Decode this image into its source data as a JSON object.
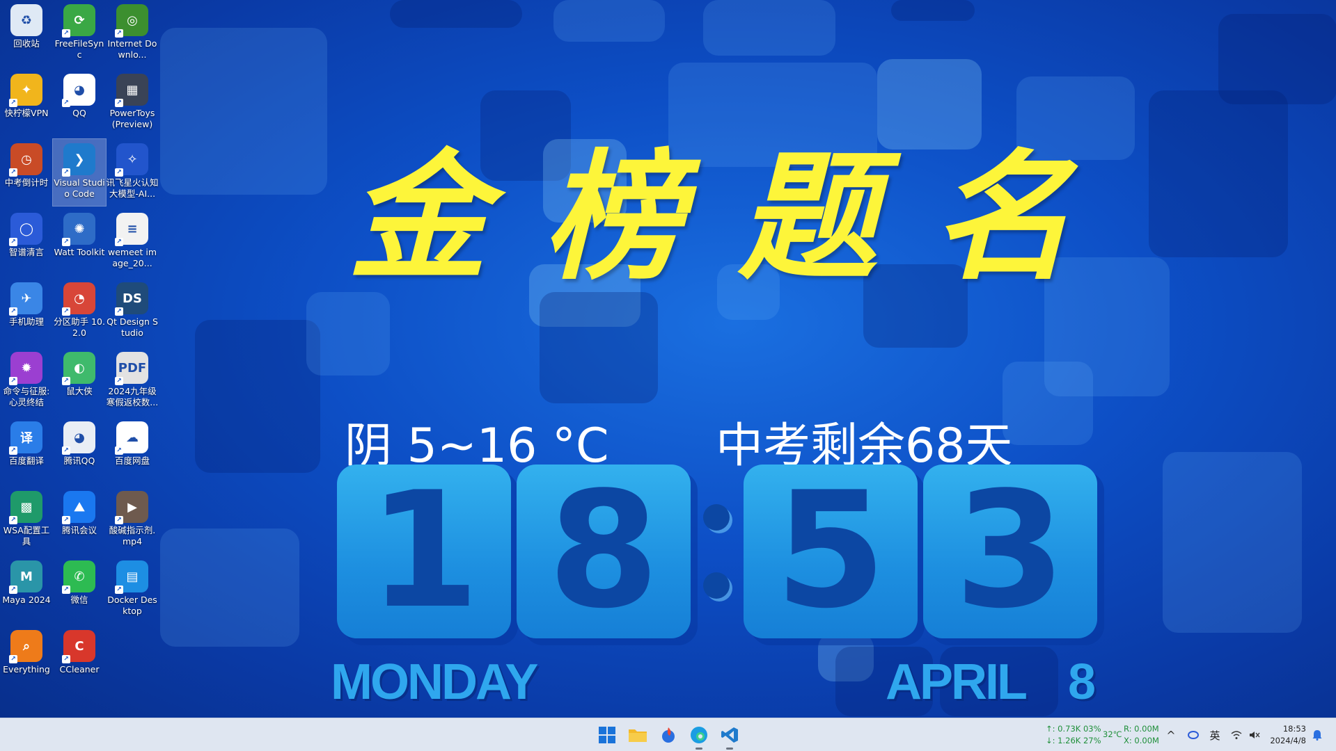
{
  "desktop_icons": [
    {
      "label": "回收站",
      "color": "#dfe9f5",
      "glyph": "♻"
    },
    {
      "label": "FreeFileSync",
      "color": "#3aa845",
      "glyph": "⟳"
    },
    {
      "label": "Internet Downlo...",
      "color": "#3c8f2f",
      "glyph": "◎"
    },
    {
      "label": "快柠檬VPN",
      "color": "#f1b51c",
      "glyph": "✦"
    },
    {
      "label": "QQ",
      "color": "#ffffff",
      "glyph": "◕"
    },
    {
      "label": "PowerToys (Preview)",
      "color": "#3a4356",
      "glyph": "▦"
    },
    {
      "label": "中考倒计时",
      "color": "#c94b26",
      "glyph": "◷"
    },
    {
      "label": "Visual Studio Code",
      "color": "#1f7acc",
      "glyph": "❯"
    },
    {
      "label": "讯飞星火认知大模型-AI...",
      "color": "#2255cc",
      "glyph": "✧"
    },
    {
      "label": "智谱清言",
      "color": "#2b5bd8",
      "glyph": "◯"
    },
    {
      "label": "Watt Toolkit",
      "color": "#2e6cc7",
      "glyph": "✺"
    },
    {
      "label": "wemeet image_20...",
      "color": "#f2f2f2",
      "glyph": "≡"
    },
    {
      "label": "手机助理",
      "color": "#3a86e6",
      "glyph": "✈"
    },
    {
      "label": "分区助手 10.2.0",
      "color": "#d84638",
      "glyph": "◔"
    },
    {
      "label": "Qt Design Studio",
      "color": "#1f4b7a",
      "glyph": "DS"
    },
    {
      "label": "命令与征服:心灵终结",
      "color": "#9b3fd1",
      "glyph": "✹"
    },
    {
      "label": "鼠大侠",
      "color": "#3fba6c",
      "glyph": "◐"
    },
    {
      "label": "2024九年级寒假返校数...",
      "color": "#e2e2e2",
      "glyph": "PDF"
    },
    {
      "label": "百度翻译",
      "color": "#2a7de8",
      "glyph": "译"
    },
    {
      "label": "腾讯QQ",
      "color": "#e9eef5",
      "glyph": "◕"
    },
    {
      "label": "百度网盘",
      "color": "#ffffff",
      "glyph": "☁"
    },
    {
      "label": "WSA配置工具",
      "color": "#1f9a6a",
      "glyph": "▩"
    },
    {
      "label": "腾讯会议",
      "color": "#1a78f0",
      "glyph": "⛰"
    },
    {
      "label": "酸碱指示剂.mp4",
      "color": "#6e5a4e",
      "glyph": "▶"
    },
    {
      "label": "Maya 2024",
      "color": "#2a95a8",
      "glyph": "M"
    },
    {
      "label": "微信",
      "color": "#2dbb52",
      "glyph": "✆"
    },
    {
      "label": "Docker Desktop",
      "color": "#1d8ee3",
      "glyph": "▤"
    },
    {
      "label": "Everything",
      "color": "#ee7b1a",
      "glyph": "⌕"
    },
    {
      "label": "CCleaner",
      "color": "#d8372b",
      "glyph": "C"
    }
  ],
  "slogan": [
    "金",
    "榜",
    "题",
    "名"
  ],
  "weather": "阴  5~16 °C",
  "countdown": "中考剩余68天",
  "clock": {
    "h1": "1",
    "h2": "8",
    "m1": "5",
    "m2": "3"
  },
  "date": {
    "weekday": "MONDAY",
    "month": "APRIL",
    "day": "8"
  },
  "taskbar": {
    "net_up": "↑: 0.73K 03%",
    "net_down": "↓: 1.26K 27%",
    "temp": "32℃",
    "disk_r": "R: 0.00M",
    "disk_w": "X: 0.00M",
    "ime": "英",
    "time": "18:53",
    "date": "2024/4/8"
  },
  "colors": {
    "slogan": "#fdf53a",
    "digit": "#0c47a3",
    "tile": "#2aa3ea"
  }
}
